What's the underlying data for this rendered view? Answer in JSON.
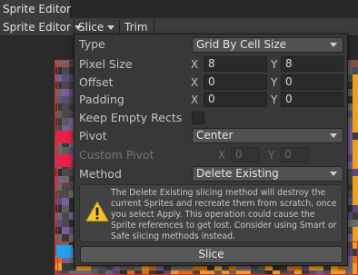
{
  "window": {
    "title": "Sprite Editor"
  },
  "toolbar": {
    "editor_mode": "Sprite Editor",
    "slice_label": "Slice",
    "trim_label": "Trim"
  },
  "slice_popup": {
    "type": {
      "label": "Type",
      "value": "Grid By Cell Size"
    },
    "pixel_size": {
      "label": "Pixel Size",
      "x_label": "X",
      "x": "8",
      "y_label": "Y",
      "y": "8"
    },
    "offset": {
      "label": "Offset",
      "x_label": "X",
      "x": "0",
      "y_label": "Y",
      "y": "0"
    },
    "padding": {
      "label": "Padding",
      "x_label": "X",
      "x": "0",
      "y_label": "Y",
      "y": "0"
    },
    "keep_empty_rects": {
      "label": "Keep Empty Rects",
      "checked": false
    },
    "pivot": {
      "label": "Pivot",
      "value": "Center"
    },
    "custom_pivot": {
      "label": "Custom Pivot",
      "x_label": "X",
      "x": "0",
      "y_label": "Y",
      "y": "0",
      "enabled": false
    },
    "method": {
      "label": "Method",
      "value": "Delete Existing"
    },
    "warning": {
      "icon": "warning-icon",
      "text": "The Delete Existing slicing method will destroy the current Sprites and recreate them from scratch, once you select Apply. This operation could cause the Sprite references to get lost. Consider using Smart or Safe slicing methods instead."
    },
    "slice_button": "Slice"
  },
  "colors": {
    "popup_bg": "#383838",
    "field_bg": "#2a2a2a",
    "selection_outline": "#d62b2b",
    "warning_yellow": "#f4c430"
  }
}
